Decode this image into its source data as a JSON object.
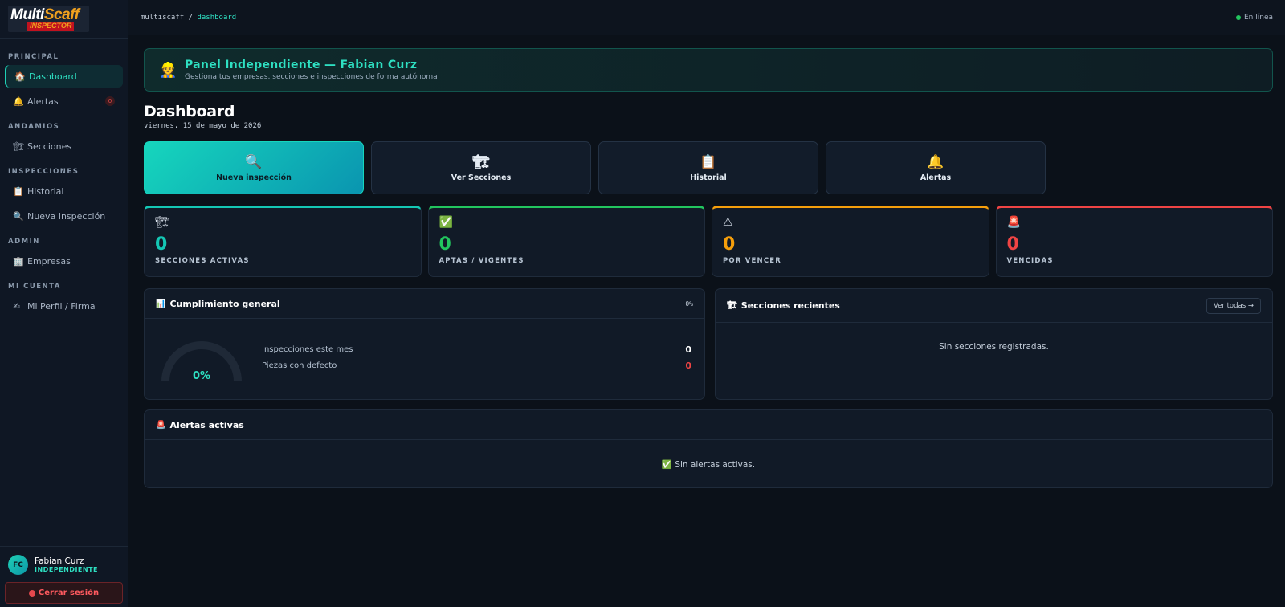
{
  "brand": {
    "logo_main": "Multi",
    "logo_accent": "Scaff",
    "logo_sub": "INSPECTOR"
  },
  "sidebar": {
    "sections": [
      {
        "title": "PRINCIPAL",
        "items": [
          {
            "icon": "🏠",
            "label": "Dashboard",
            "active": true
          },
          {
            "icon": "🔔",
            "label": "Alertas",
            "badge": "0"
          }
        ]
      },
      {
        "title": "ANDAMIOS",
        "items": [
          {
            "icon": "🏗",
            "label": "Secciones"
          }
        ]
      },
      {
        "title": "INSPECCIONES",
        "items": [
          {
            "icon": "📋",
            "label": "Historial"
          },
          {
            "icon": "🔍",
            "label": "Nueva Inspección"
          }
        ]
      },
      {
        "title": "ADMIN",
        "items": [
          {
            "icon": "🏢",
            "label": "Empresas"
          }
        ]
      },
      {
        "title": "MI CUENTA",
        "items": [
          {
            "icon": "✍",
            "label": "Mi Perfil / Firma"
          }
        ]
      }
    ],
    "user": {
      "initials": "FC",
      "name": "Fabian Curz",
      "role": "INDEPENDIENTE"
    },
    "logout_label": "Cerrar sesión"
  },
  "topbar": {
    "crumb_root": "multiscaff",
    "crumb_sep": "/",
    "crumb_current": "dashboard",
    "status": "En línea"
  },
  "banner": {
    "icon": "👷",
    "title": "Panel Independiente — Fabian Curz",
    "subtitle": "Gestiona tus empresas, secciones e inspecciones de forma autónoma"
  },
  "page": {
    "title": "Dashboard",
    "date": "viernes, 15 de mayo de 2026"
  },
  "quick_actions": [
    {
      "icon": "🔍",
      "label": "Nueva inspección",
      "primary": true
    },
    {
      "icon": "🏗",
      "label": "Ver Secciones"
    },
    {
      "icon": "📋",
      "label": "Historial"
    },
    {
      "icon": "🔔",
      "label": "Alertas"
    }
  ],
  "stats": [
    {
      "icon": "🏗",
      "value": "0",
      "label": "SECCIONES ACTIVAS",
      "color": "#14c7b4"
    },
    {
      "icon": "✅",
      "value": "0",
      "label": "APTAS / VIGENTES",
      "color": "#22c55e"
    },
    {
      "icon": "⚠",
      "value": "0",
      "label": "POR VENCER",
      "color": "#f59e0b"
    },
    {
      "icon": "🚨",
      "value": "0",
      "label": "VENCIDAS",
      "color": "#ef4444"
    }
  ],
  "compliance": {
    "icon": "📊",
    "title": "Cumplimiento general",
    "header_value": "0%",
    "gauge_value": "0%",
    "gauge_fraction": 0,
    "metrics": [
      {
        "label": "Inspecciones este mes",
        "value": "0"
      },
      {
        "label": "Piezas con defecto",
        "value": "0",
        "red": true
      }
    ]
  },
  "recent": {
    "icon": "🏗",
    "title": "Secciones recientes",
    "button": "Ver todas →",
    "empty": "Sin secciones registradas."
  },
  "alerts": {
    "icon": "🚨",
    "title": "Alertas activas",
    "empty_icon": "✅",
    "empty": "Sin alertas activas."
  },
  "colors": {
    "accent": "#2ee0c2",
    "bg": "#0b1119",
    "panel": "#111a27"
  }
}
